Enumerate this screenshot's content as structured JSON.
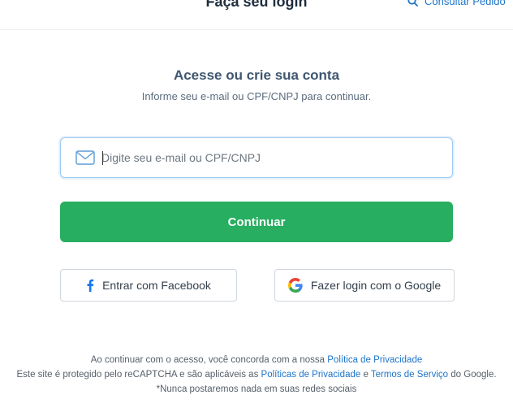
{
  "header": {
    "title": "Faça seu login",
    "consult_label": "Consultar Pedido"
  },
  "main": {
    "heading": "Acesse ou crie sua conta",
    "subheading": "Informe seu e-mail ou CPF/CNPJ para continuar.",
    "input": {
      "placeholder": "Digite seu e-mail ou CPF/CNPJ",
      "value": ""
    },
    "continue_label": "Continuar",
    "facebook_label": "Entrar com Facebook",
    "google_label": "Fazer login com o Google"
  },
  "footer": {
    "line1_text": "Ao continuar com o acesso, você concorda com a nossa ",
    "line1_link": "Política de Privacidade",
    "line2_text_a": "Este site é protegido pelo reCAPTCHA e são aplicáveis as ",
    "line2_link_a": "Políticas de Privacidade",
    "line2_text_b": " e ",
    "line2_link_b": "Termos de Serviço",
    "line2_text_c": " do Google.",
    "line3_text": "*Nunca postaremos nada em suas redes sociais"
  },
  "colors": {
    "primary_green": "#27ae60",
    "link_blue": "#1d74c9",
    "facebook_blue": "#1877f2"
  },
  "icons": [
    "search-icon",
    "mail-icon",
    "facebook-icon",
    "google-icon"
  ]
}
